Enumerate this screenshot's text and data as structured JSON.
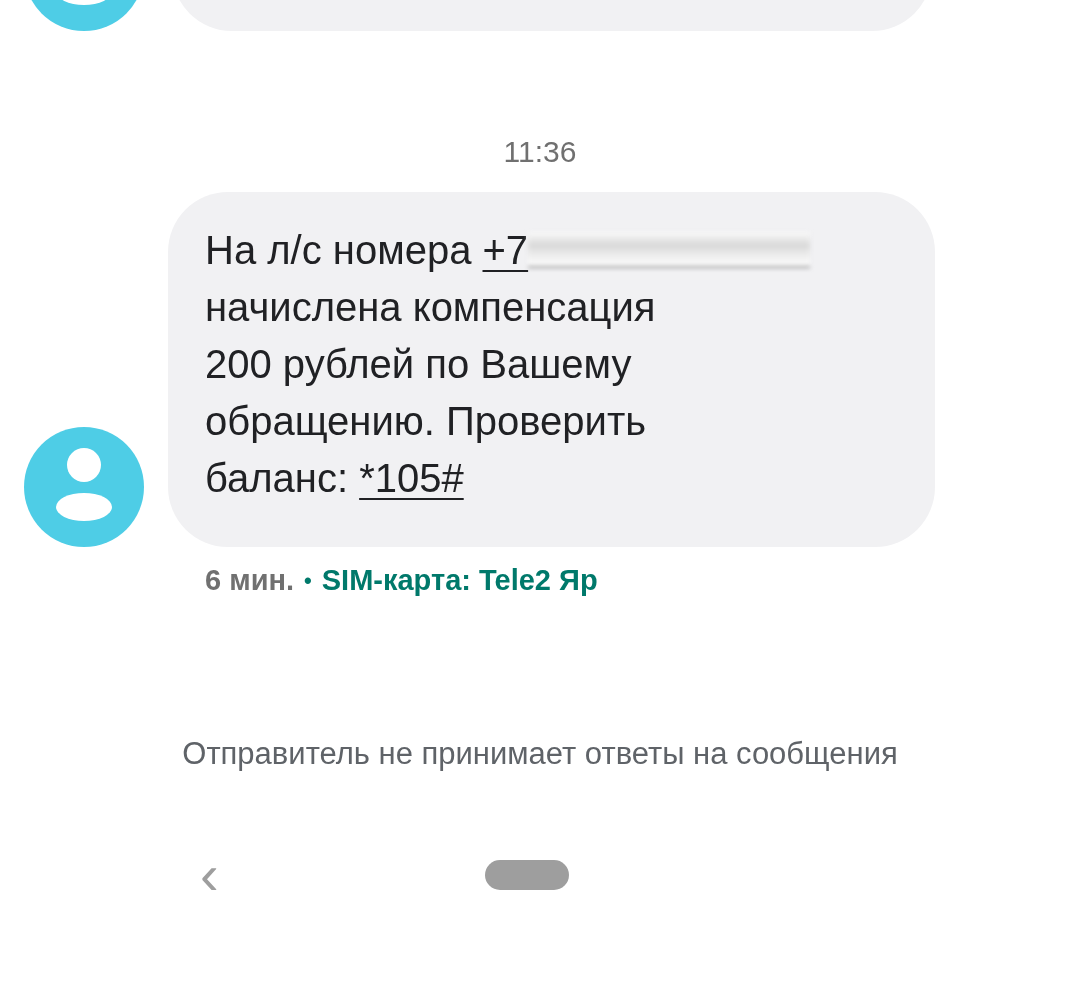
{
  "conversation": {
    "timestamp": "11:36",
    "message": {
      "segments": [
        {
          "kind": "text",
          "text": "На л/с номера "
        },
        {
          "kind": "link",
          "text": "+7",
          "redacted": true
        },
        {
          "kind": "text",
          "text": "\nначислена компенсация\n200 рублей по Вашему\nобращению. Проверить\nбаланс: "
        },
        {
          "kind": "link",
          "text": "*105#",
          "redacted": false
        }
      ],
      "age": "6 мин.",
      "separator": "•",
      "sim": "SIM-карта: Tele2 Яр"
    }
  },
  "notice": "Отправитель не принимает ответы на сообщения",
  "nav_bar": {
    "back": "‹"
  }
}
